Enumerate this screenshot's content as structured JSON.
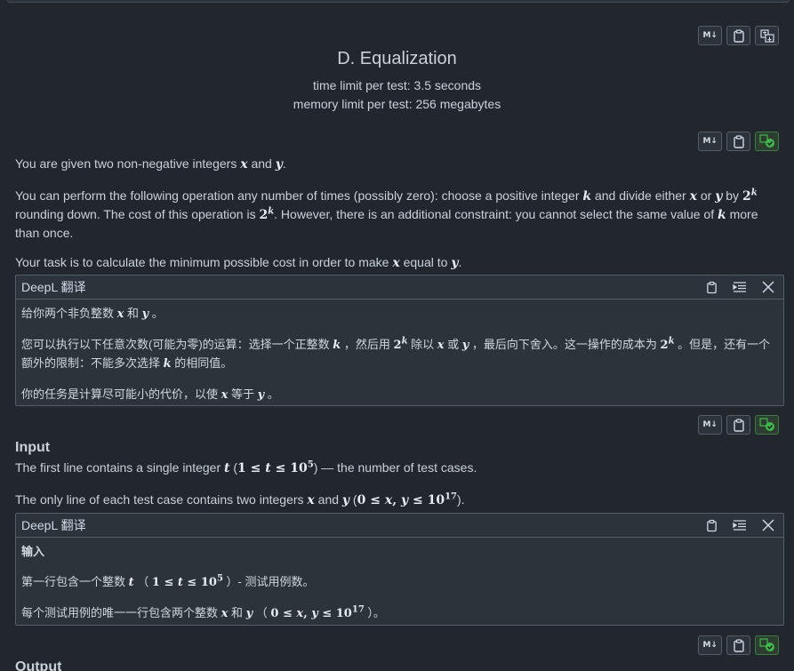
{
  "problem": {
    "title": "D. Equalization",
    "time_limit": "time limit per test: 3.5 seconds",
    "memory_limit": "memory limit per test: 256 megabytes"
  },
  "toolbar": {
    "md_label": "M↓"
  },
  "statement": {
    "p1_a": "You are given two non-negative integers ",
    "p1_x": "x",
    "p1_b": " and ",
    "p1_y": "y",
    "p1_c": ".",
    "p2_a": "You can perform the following operation any number of times (possibly zero): choose a positive integer ",
    "p2_k": "k",
    "p2_b": " and divide either ",
    "p2_x": "x",
    "p2_c": " or ",
    "p2_y": "y",
    "p2_d": " by ",
    "p2_two": "2",
    "p2_kexp": "k",
    "p2_e": " rounding down. The cost of this operation is ",
    "p2_two2": "2",
    "p2_kexp2": "k",
    "p2_f": ". However, there is an additional constraint: you cannot select the same value of ",
    "p2_k2": "k",
    "p2_g": " more than once.",
    "p3_a": "Your task is to calculate the minimum possible cost in order to make ",
    "p3_x": "x",
    "p3_b": " equal to ",
    "p3_y": "y",
    "p3_c": "."
  },
  "translation1": {
    "header": "DeepL 翻译",
    "l1_a": "给你两个非负整数 ",
    "l1_x": "x",
    "l1_b": " 和 ",
    "l1_y": "y",
    "l1_c": " 。",
    "l2_a": "您可以执行以下任意次数(可能为零)的运算：选择一个正整数 ",
    "l2_k": "k",
    "l2_b": " ，然后用 ",
    "l2_two": "2",
    "l2_kexp": "k",
    "l2_c": " 除以 ",
    "l2_x": "x",
    "l2_d": " 或 ",
    "l2_y": "y",
    "l2_e": " ，最后向下舍入。这一操作的成本为 ",
    "l2_two2": "2",
    "l2_kexp2": "k",
    "l2_f": " 。但是，还有一个额外的限制：不能多次选择 ",
    "l2_k2": "k",
    "l2_g": " 的相同值。",
    "l3_a": "你的任务是计算尽可能小的代价，以使 ",
    "l3_x": "x",
    "l3_b": " 等于 ",
    "l3_y": "y",
    "l3_c": " 。"
  },
  "input_section": {
    "title": "Input",
    "p1_a": "The first line contains a single integer ",
    "p1_t": "t",
    "p1_math_open": " (",
    "p1_one": "1",
    "p1_le": " ≤ ",
    "p1_t2": "t",
    "p1_le2": " ≤ ",
    "p1_ten": "10",
    "p1_exp": "5",
    "p1_math_close": ")",
    "p1_b": " — the number of test cases.",
    "p2_a": "The only line of each test case contains two integers ",
    "p2_x": "x",
    "p2_b": " and ",
    "p2_y": "y",
    "p2_math_open": " (",
    "p2_zero": "0",
    "p2_le": " ≤ ",
    "p2_xy": "x",
    "p2_comma": ", ",
    "p2_y2": "y",
    "p2_le2": " ≤ ",
    "p2_ten": "10",
    "p2_exp": "17",
    "p2_math_close": ").",
    "p2_end": ""
  },
  "translation2": {
    "header": "DeepL 翻译",
    "title": "输入",
    "l1_a": "第一行包含一个整数 ",
    "l1_t": "t",
    "l1_b": " （ ",
    "l1_one": "1",
    "l1_le": " ≤ ",
    "l1_t2": "t",
    "l1_le2": " ≤ ",
    "l1_ten": "10",
    "l1_exp": "5",
    "l1_c": " ）- 测试用例数。",
    "l2_a": "每个测试用例的唯一一行包含两个整数 ",
    "l2_x": "x",
    "l2_b": " 和 ",
    "l2_y": "y",
    "l2_c": " （ ",
    "l2_zero": "0",
    "l2_le": " ≤ ",
    "l2_x2": "x",
    "l2_comma": ", ",
    "l2_y2": "y",
    "l2_le2": " ≤ ",
    "l2_ten": "10",
    "l2_exp": "17",
    "l2_d": " ）。"
  },
  "output_section": {
    "title": "Output"
  },
  "colors": {
    "background": "#22272e",
    "panel": "#2d333b",
    "border": "#545d68",
    "accent_green": "#3fb950"
  }
}
